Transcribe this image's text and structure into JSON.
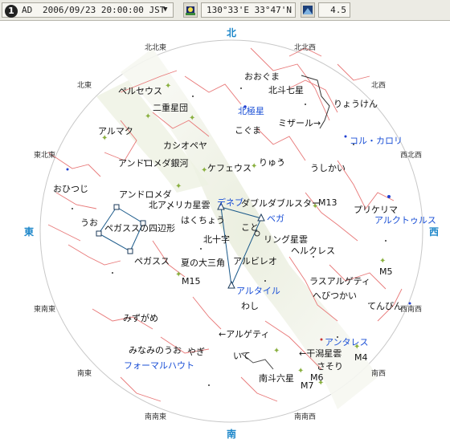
{
  "toolbar": {
    "badge": "1",
    "era": "AD",
    "datetime": "2006/09/23 20:00:00 JST",
    "location": "130°33'E 33°47'N",
    "magnitude": "4.5"
  },
  "directions": {
    "north": "北",
    "south": "南",
    "east": "東",
    "west": "西",
    "nne": "北北東",
    "ne": "北東",
    "ene": "東北東",
    "ese": "東南東",
    "se": "南東",
    "sse": "南南東",
    "nnw": "北北西",
    "nw": "北西",
    "wnw": "西北西",
    "wsw": "西南西",
    "sw": "南西",
    "ssw": "南南西"
  },
  "labels": {
    "ookuma": "おおぐま",
    "hokuto": "北斗七星",
    "ryouken": "りょうけん",
    "perseus": "ペルセウス",
    "pleiades": "二重星団",
    "hokkyoku": "北極星",
    "koguma": "こぐま",
    "mizar": "ミザール→",
    "almak": "アルマク",
    "cassiopeia": "カシオペヤ",
    "cor_caroli": "コル・カロリ",
    "andromeda_galaxy": "アンドロメダ銀河",
    "cepheus": "ケフェウス",
    "ryu": "りゅう",
    "ushikai": "うしかい",
    "ohitsuji": "おひつじ",
    "andromeda": "アンドロメダ",
    "na_nebula": "北アメリカ星雲",
    "deneb": "デネブ",
    "double_double": "ダブルダブルスター",
    "m13": "M13",
    "prikeima": "プリケリマ",
    "arcturus": "アルクトゥルス",
    "uo": "うお",
    "pegasus_sq": "ペガススの四辺形",
    "hakuchou": "はくちょう",
    "koto": "こと",
    "vega": "ベガ",
    "hokujuji": "北十字",
    "ring_nebula": "リング星雲",
    "herakles": "ヘルクレス",
    "pegasus": "ペガスス",
    "summer_triangle": "夏の大三角",
    "albireo": "アルビレオ",
    "m5": "M5",
    "m15": "M15",
    "altair": "アルタイル",
    "ras_algethi": "ラスアルゲティ",
    "washi": "わし",
    "hebitsukai": "へびつかい",
    "tenbin": "てんびん",
    "mizugame": "みずがめ",
    "al_geti": "←アルゲティ",
    "minamino_uo": "みなみのうお",
    "yagi": "やぎ",
    "antares": "アンタレス",
    "fomalhaut": "フォーマルハウト",
    "ite": "いて",
    "hiyoboshi": "←干潟星雲",
    "m4": "M4",
    "sasori": "さそり",
    "nanto": "南斗六星",
    "m6": "M6",
    "m7": "M7"
  }
}
